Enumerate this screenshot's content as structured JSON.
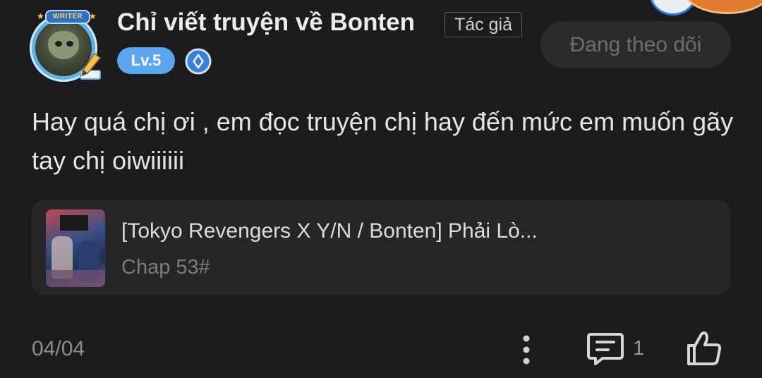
{
  "header": {
    "username": "Chỉ viết truyện về Bonten",
    "author_tag": "Tác giả",
    "level": "Lv.5",
    "follow_label": "Đang theo dõi",
    "avatar_frame_text": "WRITER"
  },
  "comment": {
    "text": "Hay quá chị ơi , em đọc truyện chị hay đến mức em muốn gãy tay chị oiwiiiiii"
  },
  "story": {
    "title": "[Tokyo Revengers X Y/N / Bonten] Phải Lò...",
    "chapter": "Chap 53#"
  },
  "footer": {
    "date": "04/04",
    "reply_count": "1"
  },
  "colors": {
    "background": "#1c1c1e",
    "card": "#262628",
    "level_badge": "#5aa7f0",
    "follow_button": "#2b2b2d"
  },
  "icons": {
    "more": "more-vertical-icon",
    "comment": "comment-icon",
    "like": "thumbs-up-icon",
    "badge": "diamond-badge-icon"
  }
}
